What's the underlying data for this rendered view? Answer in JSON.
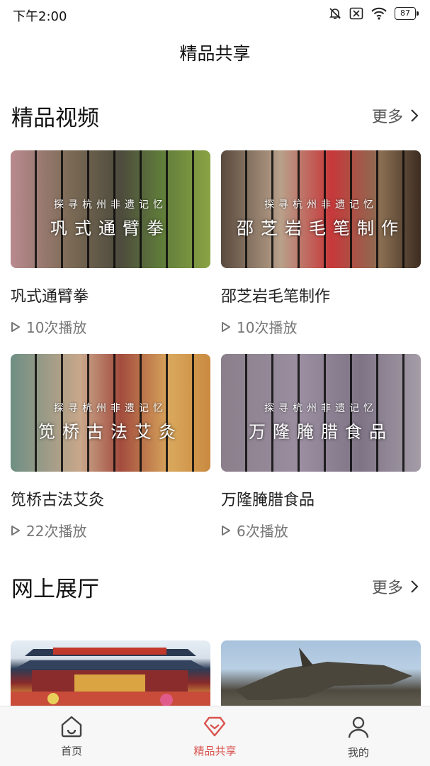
{
  "status_bar": {
    "time": "下午2:00",
    "battery": "87"
  },
  "header": {
    "title": "精品共享"
  },
  "videos_section": {
    "title": "精品视频",
    "more_label": "更多",
    "items": [
      {
        "thumb_subtitle": "探寻杭州非遗记忆",
        "thumb_title": "巩式通臂拳",
        "name": "巩式通臂拳",
        "plays": "10次播放"
      },
      {
        "thumb_subtitle": "探寻杭州非遗记忆",
        "thumb_title": "邵芝岩毛笔制作",
        "name": "邵芝岩毛笔制作",
        "plays": "10次播放"
      },
      {
        "thumb_subtitle": "探寻杭州非遗记忆",
        "thumb_title": "笕桥古法艾灸",
        "name": "笕桥古法艾灸",
        "plays": "22次播放"
      },
      {
        "thumb_subtitle": "探寻杭州非遗记忆",
        "thumb_title": "万隆腌腊食品",
        "name": "万隆腌腊食品",
        "plays": "6次播放"
      }
    ]
  },
  "halls_section": {
    "title": "网上展厅",
    "more_label": "更多"
  },
  "bottom_nav": {
    "items": [
      {
        "label": "首页",
        "icon": "home-icon",
        "active": false
      },
      {
        "label": "精品共享",
        "icon": "heart-diamond-icon",
        "active": true
      },
      {
        "label": "我的",
        "icon": "person-icon",
        "active": false
      }
    ]
  },
  "colors": {
    "accent": "#d9534f",
    "text": "#222222",
    "muted": "#777777"
  }
}
